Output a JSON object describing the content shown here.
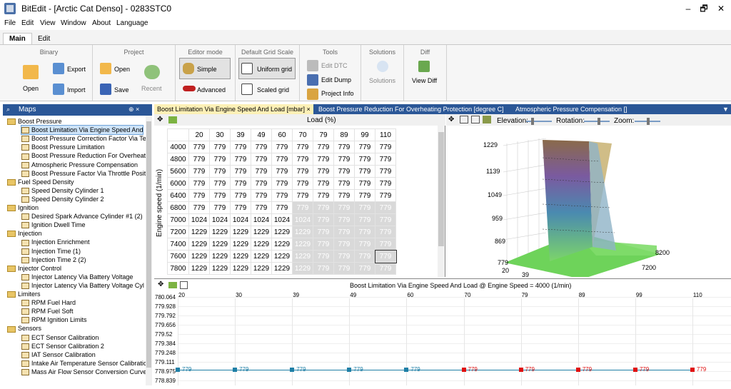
{
  "title_bar": {
    "title": "BitEdit - [Arctic Cat Denso] - 0283STC0",
    "minimize": "–",
    "restore": "🗗",
    "close": "✕"
  },
  "menu": [
    "File",
    "Edit",
    "View",
    "Window",
    "About",
    "Language"
  ],
  "ribbon_tabs": [
    "Main",
    "Edit"
  ],
  "ribbon": {
    "binary": {
      "title": "Binary",
      "open": "Open",
      "export": "Export",
      "import": "Import"
    },
    "project": {
      "title": "Project",
      "open": "Open",
      "save": "Save",
      "recent": "Recent"
    },
    "editor_mode": {
      "title": "Editor mode",
      "simple": "Simple",
      "advanced": "Advanced"
    },
    "grid_scale": {
      "title": "Default Grid Scale",
      "uniform": "Uniform grid",
      "scaled": "Scaled grid"
    },
    "tools": {
      "title": "Tools",
      "edit_dtc": "Edit DTC",
      "edit_dump": "Edit Dump",
      "project_info": "Project Info"
    },
    "solutions": {
      "title": "Solutions",
      "solutions": "Solutions"
    },
    "diff": {
      "title": "Diff",
      "view_diff": "View Diff"
    }
  },
  "maps_panel": {
    "title": "Maps",
    "pin": "⊕ ×"
  },
  "tree": [
    {
      "type": "folder",
      "label": "Boost Pressure"
    },
    {
      "type": "map",
      "label": "Boost Limitation Via Engine Speed And",
      "selected": true
    },
    {
      "type": "map",
      "label": "Boost Pressure Correction Factor Via Te"
    },
    {
      "type": "map",
      "label": "Boost Pressure Limitation"
    },
    {
      "type": "map",
      "label": "Boost Pressure Reduction For Overheati"
    },
    {
      "type": "map",
      "label": "Atmospheric Pressure Compensation"
    },
    {
      "type": "map",
      "label": "Boost Pressure Factor Via Throttle Positi"
    },
    {
      "type": "folder",
      "label": "Fuel Speed Density"
    },
    {
      "type": "map",
      "label": "Speed Density Cylinder 1"
    },
    {
      "type": "map",
      "label": "Speed Density Cylinder 2"
    },
    {
      "type": "folder",
      "label": "Ignition"
    },
    {
      "type": "map",
      "label": "Desired Spark Advance Cylinder #1 (2)"
    },
    {
      "type": "map",
      "label": "Ignition Dwell Time"
    },
    {
      "type": "folder",
      "label": "Injection"
    },
    {
      "type": "map",
      "label": "Injection Enrichment"
    },
    {
      "type": "map",
      "label": "Injection Time (1)"
    },
    {
      "type": "map",
      "label": "Injection Time 2 (2)"
    },
    {
      "type": "folder",
      "label": "Injector Control"
    },
    {
      "type": "map",
      "label": "Injector Latency Via Battery Voltage"
    },
    {
      "type": "map",
      "label": "Injector Latency Via Battery Voltage Cyl"
    },
    {
      "type": "folder",
      "label": "Limiters"
    },
    {
      "type": "map",
      "label": "RPM Fuel Hard"
    },
    {
      "type": "map",
      "label": "RPM Fuel Soft"
    },
    {
      "type": "map",
      "label": "RPM Ignition Limits"
    },
    {
      "type": "folder",
      "label": "Sensors"
    },
    {
      "type": "map",
      "label": "ECT Sensor Calibration"
    },
    {
      "type": "map",
      "label": "ECT Sensor Calibration 2"
    },
    {
      "type": "map",
      "label": "IAT Sensor Calibration"
    },
    {
      "type": "map",
      "label": "Intake Air Temperature Sensor Calibratic"
    },
    {
      "type": "map",
      "label": "Mass Air Flow Sensor Conversion Curve"
    }
  ],
  "doc_tabs": [
    "Boost Limitation Via Engine Speed And Load [mbar]",
    "Boost Pressure Reduction For Overheating Protection [degree C]",
    "Atmospheric Pressure Compensation []"
  ],
  "doc_tab_close": "×",
  "doc_tabs_menu": "▼",
  "grid": {
    "x_label": "Load (%)",
    "y_label": "Engine speed (1/min)",
    "columns": [
      20,
      30,
      39,
      49,
      60,
      70,
      79,
      89,
      99,
      110
    ],
    "rows": [
      {
        "rpm": 4000,
        "values": [
          779,
          779,
          779,
          779,
          779,
          779,
          779,
          779,
          779,
          779
        ]
      },
      {
        "rpm": 4800,
        "values": [
          779,
          779,
          779,
          779,
          779,
          779,
          779,
          779,
          779,
          779
        ]
      },
      {
        "rpm": 5600,
        "values": [
          779,
          779,
          779,
          779,
          779,
          779,
          779,
          779,
          779,
          779
        ]
      },
      {
        "rpm": 6000,
        "values": [
          779,
          779,
          779,
          779,
          779,
          779,
          779,
          779,
          779,
          779
        ]
      },
      {
        "rpm": 6400,
        "values": [
          779,
          779,
          779,
          779,
          779,
          779,
          779,
          779,
          779,
          779
        ]
      },
      {
        "rpm": 6800,
        "values": [
          779,
          779,
          779,
          779,
          779,
          779,
          779,
          779,
          779,
          779
        ]
      },
      {
        "rpm": 7000,
        "values": [
          1024,
          1024,
          1024,
          1024,
          1024,
          1024,
          779,
          779,
          779,
          779
        ]
      },
      {
        "rpm": 7200,
        "values": [
          1229,
          1229,
          1229,
          1229,
          1229,
          1229,
          779,
          779,
          779,
          779
        ]
      },
      {
        "rpm": 7400,
        "values": [
          1229,
          1229,
          1229,
          1229,
          1229,
          1229,
          779,
          779,
          779,
          779
        ]
      },
      {
        "rpm": 7600,
        "values": [
          1229,
          1229,
          1229,
          1229,
          1229,
          1229,
          779,
          779,
          779,
          779
        ]
      },
      {
        "rpm": 7800,
        "values": [
          1229,
          1229,
          1229,
          1229,
          1229,
          1229,
          779,
          779,
          779,
          779
        ]
      }
    ]
  },
  "view3d": {
    "elevation_label": "Elevation:",
    "rotation_label": "Rotation:",
    "zoom_label": "Zoom:",
    "z_ticks": [
      "1229",
      "1139",
      "1049",
      "959",
      "869",
      "779"
    ],
    "x_ticks": [
      "20",
      "39"
    ],
    "y_ticks": [
      "8200",
      "7200"
    ]
  },
  "chart_data": {
    "type": "line",
    "title": "Boost Limitation Via Engine Speed And Load @ Engine Speed = 4000 (1/min)",
    "x": [
      20,
      30,
      39,
      49,
      60,
      70,
      79,
      89,
      99,
      110
    ],
    "y_ticks": [
      "780.064",
      "779.928",
      "779.792",
      "779.656",
      "779.52",
      "779.384",
      "779.248",
      "779.111",
      "778.975",
      "778.839"
    ],
    "ylim": [
      778.839,
      780.064
    ],
    "series": [
      {
        "values": [
          779,
          779,
          779,
          779,
          779,
          779,
          779,
          779,
          779,
          779
        ]
      }
    ],
    "point_labels": [
      "779",
      "779",
      "779",
      "779",
      "779",
      "779",
      "779",
      "779",
      "779",
      "779"
    ],
    "point_colors": [
      "#1f7fa6",
      "#1f7fa6",
      "#1f7fa6",
      "#1f7fa6",
      "#1f7fa6",
      "#e01010",
      "#e01010",
      "#e01010",
      "#e01010",
      "#e01010"
    ]
  }
}
